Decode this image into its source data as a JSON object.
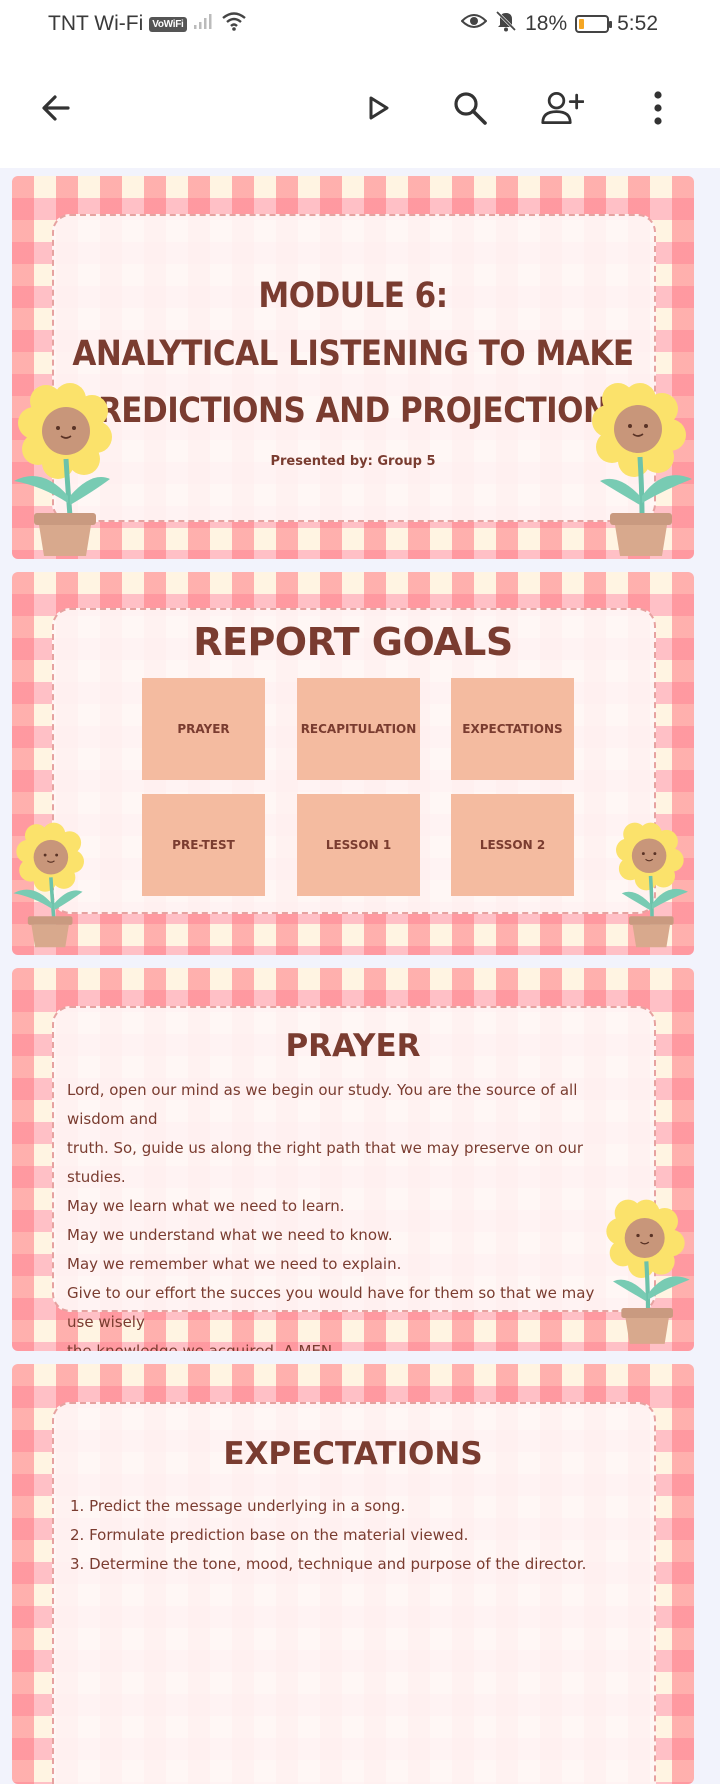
{
  "status_bar": {
    "carrier": "TNT Wi-Fi",
    "vowifi_badge": "VoWiFi",
    "battery_percent": "18%",
    "battery_level": 0.18,
    "time": "5:52"
  },
  "app_bar": {
    "icons": [
      "back-arrow-icon",
      "play-icon",
      "search-icon",
      "add-person-icon",
      "more-vertical-icon"
    ]
  },
  "slides": {
    "title_slide": {
      "title_line1": "MODULE 6:",
      "title_line2": "ANALYTICAL LISTENING TO MAKE",
      "title_line3": "PREDICTIONS AND PROJECTIONS",
      "presented_by": "Presented by: Group 5"
    },
    "goals_slide": {
      "heading": "REPORT GOALS",
      "goals": [
        "PRAYER",
        "RECAPITULATION",
        "EXPECTATIONS",
        "PRE-TEST",
        "LESSON 1",
        "LESSON 2"
      ]
    },
    "prayer_slide": {
      "heading": "PRAYER",
      "lines": [
        "Lord, open our mind as we begin our study. You are the source of all wisdom and",
        "truth. So, guide us along the right path that we may preserve on our studies.",
        "May we learn what we need to learn.",
        "May we understand what we need to know.",
        "May we remember what we need to explain.",
        "Give  to our effort the succes you would have for them so that we may use wisely",
        "the knowledge we acquired. A MEN."
      ]
    },
    "expectations_slide": {
      "heading": "EXPECTATIONS",
      "items": [
        "1. Predict the message underlying in a song.",
        "2. Formulate prediction base on the material viewed.",
        "3. Determine the tone, mood, technique and purpose of the director."
      ]
    }
  },
  "colors": {
    "text_brown": "#7a3c30",
    "goal_box": "#f4bba0",
    "gingham_red": "#ff7882",
    "gingham_pink": "#ff96af",
    "gingham_cream": "#fff4e2"
  }
}
